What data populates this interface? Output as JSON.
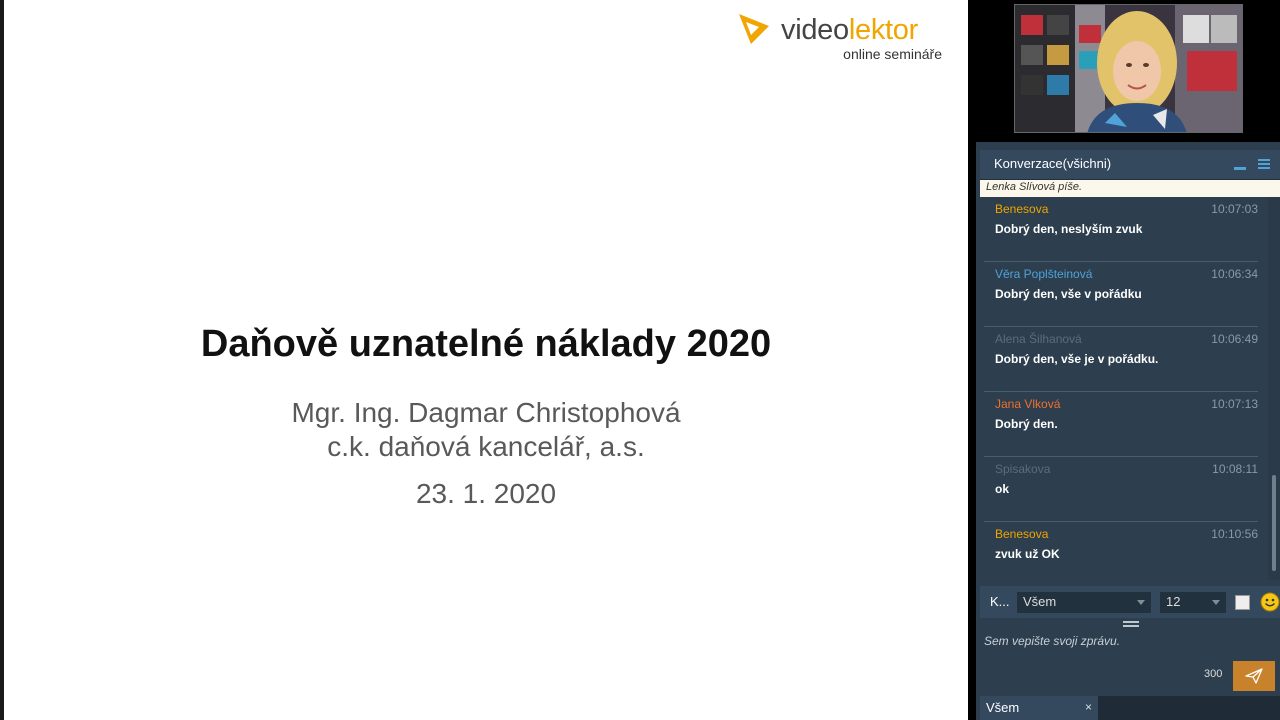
{
  "logo": {
    "word_part1": "video",
    "word_part2": "lektor",
    "tagline": "online semináře",
    "accent_color": "#f0a500"
  },
  "slide": {
    "title": "Daňově uznatelné náklady 2020",
    "author_line1": "Mgr. Ing. Dagmar Christophová",
    "author_line2": "c.k. daňová kancelář, a.s.",
    "date": "23. 1. 2020"
  },
  "chat": {
    "header_title": "Konverzace(všichni)",
    "typing_indicator": "Lenka Slívová píše.",
    "messages": [
      {
        "author": "Benesova",
        "author_color": "#f0a500",
        "time": "10:07:03",
        "text": "Dobrý den, neslyším zvuk"
      },
      {
        "author": "Věra Poplšteinová",
        "author_color": "#4fa3d9",
        "time": "10:06:34",
        "text": "Dobrý den, vše v pořádku"
      },
      {
        "author": "Alena Šilhanová",
        "author_color": "#5d6c78",
        "time": "10:06:49",
        "text": "Dobrý den, vše je v  pořádku."
      },
      {
        "author": "Jana Vlková",
        "author_color": "#f07030",
        "time": "10:07:13",
        "text": "Dobrý den."
      },
      {
        "author": "Spisakova",
        "author_color": "#5d6c78",
        "time": "10:08:11",
        "text": "ok"
      },
      {
        "author": "Benesova",
        "author_color": "#f0a500",
        "time": "10:10:56",
        "text": "zvuk už OK"
      }
    ],
    "controls": {
      "k_label": "K...",
      "recipient_value": "Všem",
      "font_size_value": "12"
    },
    "compose": {
      "placeholder": "Sem vepište svoji zprávu.",
      "char_counter": "300"
    },
    "bottom_tab": {
      "label": "Všem",
      "close_glyph": "×"
    }
  },
  "icons": [
    "play-logo-icon",
    "minimize-icon",
    "menu-icon",
    "dropdown-caret-icon",
    "smiley-icon",
    "send-icon",
    "close-icon",
    "splitter-grip-icon"
  ]
}
